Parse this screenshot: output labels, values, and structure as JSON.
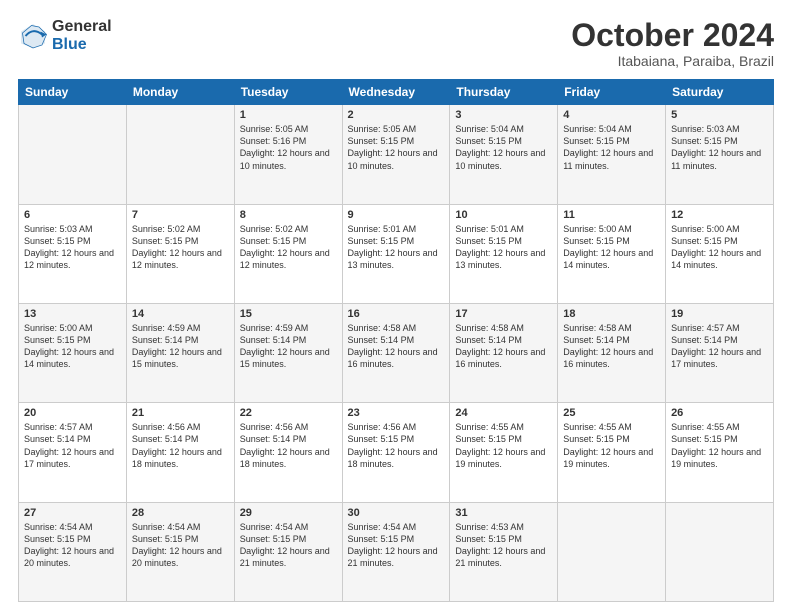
{
  "header": {
    "logo_general": "General",
    "logo_blue": "Blue",
    "month": "October 2024",
    "location": "Itabaiana, Paraiba, Brazil"
  },
  "weekdays": [
    "Sunday",
    "Monday",
    "Tuesday",
    "Wednesday",
    "Thursday",
    "Friday",
    "Saturday"
  ],
  "weeks": [
    [
      {
        "day": "",
        "sunrise": "",
        "sunset": "",
        "daylight": ""
      },
      {
        "day": "",
        "sunrise": "",
        "sunset": "",
        "daylight": ""
      },
      {
        "day": "1",
        "sunrise": "Sunrise: 5:05 AM",
        "sunset": "Sunset: 5:16 PM",
        "daylight": "Daylight: 12 hours and 10 minutes."
      },
      {
        "day": "2",
        "sunrise": "Sunrise: 5:05 AM",
        "sunset": "Sunset: 5:15 PM",
        "daylight": "Daylight: 12 hours and 10 minutes."
      },
      {
        "day": "3",
        "sunrise": "Sunrise: 5:04 AM",
        "sunset": "Sunset: 5:15 PM",
        "daylight": "Daylight: 12 hours and 10 minutes."
      },
      {
        "day": "4",
        "sunrise": "Sunrise: 5:04 AM",
        "sunset": "Sunset: 5:15 PM",
        "daylight": "Daylight: 12 hours and 11 minutes."
      },
      {
        "day": "5",
        "sunrise": "Sunrise: 5:03 AM",
        "sunset": "Sunset: 5:15 PM",
        "daylight": "Daylight: 12 hours and 11 minutes."
      }
    ],
    [
      {
        "day": "6",
        "sunrise": "Sunrise: 5:03 AM",
        "sunset": "Sunset: 5:15 PM",
        "daylight": "Daylight: 12 hours and 12 minutes."
      },
      {
        "day": "7",
        "sunrise": "Sunrise: 5:02 AM",
        "sunset": "Sunset: 5:15 PM",
        "daylight": "Daylight: 12 hours and 12 minutes."
      },
      {
        "day": "8",
        "sunrise": "Sunrise: 5:02 AM",
        "sunset": "Sunset: 5:15 PM",
        "daylight": "Daylight: 12 hours and 12 minutes."
      },
      {
        "day": "9",
        "sunrise": "Sunrise: 5:01 AM",
        "sunset": "Sunset: 5:15 PM",
        "daylight": "Daylight: 12 hours and 13 minutes."
      },
      {
        "day": "10",
        "sunrise": "Sunrise: 5:01 AM",
        "sunset": "Sunset: 5:15 PM",
        "daylight": "Daylight: 12 hours and 13 minutes."
      },
      {
        "day": "11",
        "sunrise": "Sunrise: 5:00 AM",
        "sunset": "Sunset: 5:15 PM",
        "daylight": "Daylight: 12 hours and 14 minutes."
      },
      {
        "day": "12",
        "sunrise": "Sunrise: 5:00 AM",
        "sunset": "Sunset: 5:15 PM",
        "daylight": "Daylight: 12 hours and 14 minutes."
      }
    ],
    [
      {
        "day": "13",
        "sunrise": "Sunrise: 5:00 AM",
        "sunset": "Sunset: 5:15 PM",
        "daylight": "Daylight: 12 hours and 14 minutes."
      },
      {
        "day": "14",
        "sunrise": "Sunrise: 4:59 AM",
        "sunset": "Sunset: 5:14 PM",
        "daylight": "Daylight: 12 hours and 15 minutes."
      },
      {
        "day": "15",
        "sunrise": "Sunrise: 4:59 AM",
        "sunset": "Sunset: 5:14 PM",
        "daylight": "Daylight: 12 hours and 15 minutes."
      },
      {
        "day": "16",
        "sunrise": "Sunrise: 4:58 AM",
        "sunset": "Sunset: 5:14 PM",
        "daylight": "Daylight: 12 hours and 16 minutes."
      },
      {
        "day": "17",
        "sunrise": "Sunrise: 4:58 AM",
        "sunset": "Sunset: 5:14 PM",
        "daylight": "Daylight: 12 hours and 16 minutes."
      },
      {
        "day": "18",
        "sunrise": "Sunrise: 4:58 AM",
        "sunset": "Sunset: 5:14 PM",
        "daylight": "Daylight: 12 hours and 16 minutes."
      },
      {
        "day": "19",
        "sunrise": "Sunrise: 4:57 AM",
        "sunset": "Sunset: 5:14 PM",
        "daylight": "Daylight: 12 hours and 17 minutes."
      }
    ],
    [
      {
        "day": "20",
        "sunrise": "Sunrise: 4:57 AM",
        "sunset": "Sunset: 5:14 PM",
        "daylight": "Daylight: 12 hours and 17 minutes."
      },
      {
        "day": "21",
        "sunrise": "Sunrise: 4:56 AM",
        "sunset": "Sunset: 5:14 PM",
        "daylight": "Daylight: 12 hours and 18 minutes."
      },
      {
        "day": "22",
        "sunrise": "Sunrise: 4:56 AM",
        "sunset": "Sunset: 5:14 PM",
        "daylight": "Daylight: 12 hours and 18 minutes."
      },
      {
        "day": "23",
        "sunrise": "Sunrise: 4:56 AM",
        "sunset": "Sunset: 5:15 PM",
        "daylight": "Daylight: 12 hours and 18 minutes."
      },
      {
        "day": "24",
        "sunrise": "Sunrise: 4:55 AM",
        "sunset": "Sunset: 5:15 PM",
        "daylight": "Daylight: 12 hours and 19 minutes."
      },
      {
        "day": "25",
        "sunrise": "Sunrise: 4:55 AM",
        "sunset": "Sunset: 5:15 PM",
        "daylight": "Daylight: 12 hours and 19 minutes."
      },
      {
        "day": "26",
        "sunrise": "Sunrise: 4:55 AM",
        "sunset": "Sunset: 5:15 PM",
        "daylight": "Daylight: 12 hours and 19 minutes."
      }
    ],
    [
      {
        "day": "27",
        "sunrise": "Sunrise: 4:54 AM",
        "sunset": "Sunset: 5:15 PM",
        "daylight": "Daylight: 12 hours and 20 minutes."
      },
      {
        "day": "28",
        "sunrise": "Sunrise: 4:54 AM",
        "sunset": "Sunset: 5:15 PM",
        "daylight": "Daylight: 12 hours and 20 minutes."
      },
      {
        "day": "29",
        "sunrise": "Sunrise: 4:54 AM",
        "sunset": "Sunset: 5:15 PM",
        "daylight": "Daylight: 12 hours and 21 minutes."
      },
      {
        "day": "30",
        "sunrise": "Sunrise: 4:54 AM",
        "sunset": "Sunset: 5:15 PM",
        "daylight": "Daylight: 12 hours and 21 minutes."
      },
      {
        "day": "31",
        "sunrise": "Sunrise: 4:53 AM",
        "sunset": "Sunset: 5:15 PM",
        "daylight": "Daylight: 12 hours and 21 minutes."
      },
      {
        "day": "",
        "sunrise": "",
        "sunset": "",
        "daylight": ""
      },
      {
        "day": "",
        "sunrise": "",
        "sunset": "",
        "daylight": ""
      }
    ]
  ]
}
